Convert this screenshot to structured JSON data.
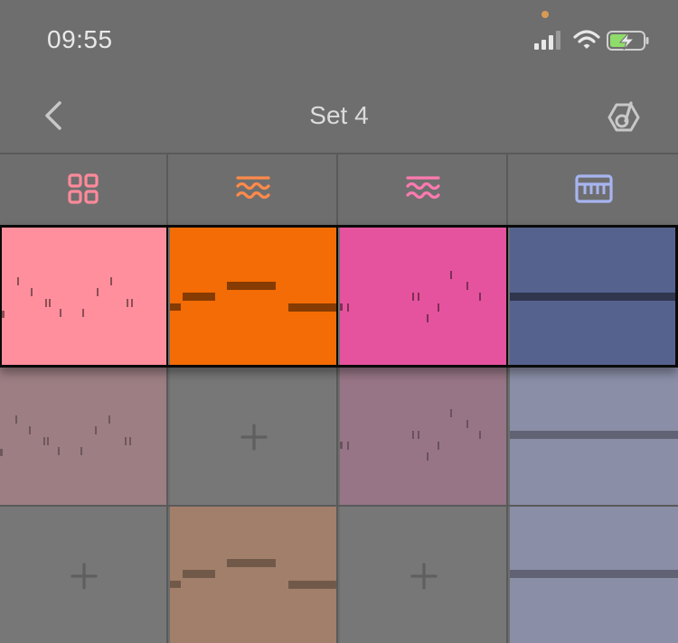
{
  "status_bar": {
    "time": "09:55",
    "camera_dot_color": "#d99a55",
    "signal_icon": "cellular-signal-icon",
    "wifi_icon": "wifi-icon",
    "battery_icon": "battery-charging-icon",
    "battery_fill_color": "#8fdc6a"
  },
  "nav": {
    "back_icon": "chevron-left-icon",
    "title": "Set 4",
    "right_icon": "sound-settings-icon"
  },
  "tracks": [
    {
      "icon": "drum-grid-icon",
      "color": "#ff8a9a"
    },
    {
      "icon": "wave-orange-icon",
      "color": "#ff8a4a"
    },
    {
      "icon": "wave-pink-icon",
      "color": "#ff7ab0"
    },
    {
      "icon": "keyboard-icon",
      "color": "#a7b4f0"
    }
  ],
  "rows": [
    {
      "state": "playing",
      "clips": [
        {
          "type": "drums",
          "color": "#ff8f9d"
        },
        {
          "type": "bass",
          "color": "#f36c05"
        },
        {
          "type": "melody",
          "color": "#e5539e"
        },
        {
          "type": "chord",
          "color": "#56628e"
        }
      ]
    },
    {
      "state": "inactive",
      "clips": [
        {
          "type": "drums",
          "color": "#9c7e83"
        },
        {
          "type": "empty",
          "color": "#777777"
        },
        {
          "type": "melody",
          "color": "#977586"
        },
        {
          "type": "chord",
          "color": "#8a8ea6"
        }
      ]
    },
    {
      "state": "inactive",
      "clips": [
        {
          "type": "empty",
          "color": "#777777"
        },
        {
          "type": "bass",
          "color": "#a27f6a"
        },
        {
          "type": "empty",
          "color": "#777777"
        },
        {
          "type": "chord",
          "color": "#8a8ea6"
        }
      ]
    }
  ]
}
